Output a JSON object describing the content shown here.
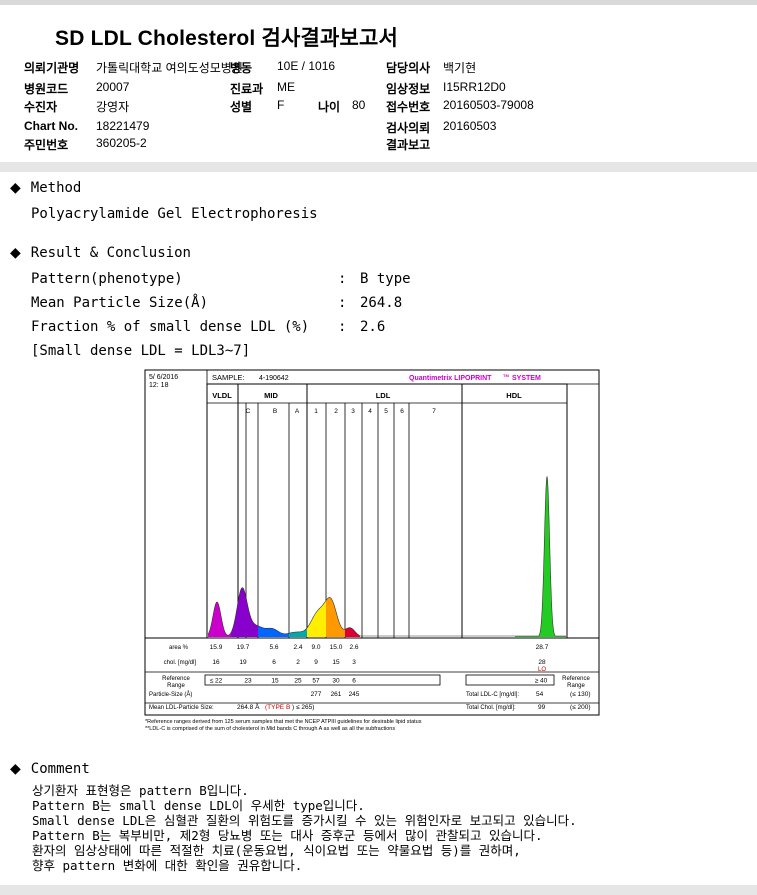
{
  "report": {
    "title": "SD LDL Cholesterol 검사결과보고서",
    "fields": {
      "hospital_label": "의뢰기관명",
      "hospital_value": "가톨릭대학교 여의도성모병원",
      "ward_label": "병동",
      "ward_value": "10E / 1016",
      "doctor_label": "담당의사",
      "doctor_value": "백기현",
      "code_label": "병원코드",
      "code_value": "20007",
      "dept_label": "진료과",
      "dept_value": "ME",
      "clinical_label": "임상정보",
      "clinical_value": "I15RR12D0",
      "patient_label": "수진자",
      "patient_value": "강영자",
      "sex_label": "성별",
      "sex_value": "F",
      "age_label": "나이",
      "age_value": "80",
      "receipt_label": "접수번호",
      "receipt_value": "20160503-79008",
      "chart_label": "Chart No.",
      "chart_value": "18221479",
      "request_label": "검사의뢰",
      "request_value": "20160503",
      "id_label": "주민번호",
      "id_value": "360205-2",
      "result_report_label": "결과보고",
      "result_report_value": ""
    }
  },
  "method": {
    "heading": "Method",
    "text": "Polyacrylamide Gel Electrophoresis"
  },
  "result": {
    "heading": "Result & Conclusion",
    "pattern_label": "Pattern(phenotype)",
    "pattern_value": "B type",
    "mps_label": "Mean Particle Size(Å)",
    "mps_value": "264.8",
    "fraction_label": "Fraction % of small dense LDL (%)",
    "fraction_value": "2.6",
    "note": "[Small dense LDL = LDL3~7]",
    "colon": ":"
  },
  "comment": {
    "heading": "Comment",
    "lines": [
      "상기환자 표현형은 pattern B입니다.",
      "Pattern B는 small dense LDL이 우세한 type입니다.",
      "Small dense LDL은 심혈관 질환의 위험도를 증가시킬 수 있는 위험인자로 보고되고 있습니다.",
      "Pattern B는 복부비만, 제2형 당뇨병 또는 대사 증후군 등에서 많이 관찰되고 있습니다.",
      "환자의 임상상태에 따른 적절한 치료(운동요법, 식이요법 또는 약물요법 등)를 권하며,",
      "향후 pattern 변화에 대한 확인을 권유합니다."
    ]
  },
  "chart_data": {
    "type": "area",
    "date": "5/ 6/2016",
    "time": "12: 18",
    "sample_label": "SAMPLE:",
    "sample_id": "4-190642",
    "brand": "Quantimetrix LIPOPRINT",
    "brand_tm": "TM",
    "brand_suffix": "SYSTEM",
    "regions": [
      "VLDL",
      "MID",
      "LDL",
      "HDL"
    ],
    "bands": [
      "C",
      "B",
      "A",
      "1",
      "2",
      "3",
      "4",
      "5",
      "6",
      "7"
    ],
    "area_label": "area %",
    "area_values": [
      "15.9",
      "19.7",
      "5.6",
      "2.4",
      "9.0",
      "15.0",
      "2.6",
      "28.7"
    ],
    "chol_label": "chol. [mg/dl]",
    "chol_values": [
      "16",
      "19",
      "6",
      "2",
      "9",
      "15",
      "3",
      "28"
    ],
    "lo_flag": "LO",
    "ref_label": "Reference Range",
    "ref_values": [
      "≤ 22",
      "23",
      "15",
      "25",
      "57",
      "30",
      "6"
    ],
    "hdl_ref": "≥ 40",
    "ref_right_label": "Reference Range",
    "particle_label": "Particle-Size (Å)",
    "particle_values": [
      "277",
      "261",
      "245"
    ],
    "mean_label": "Mean LDL-Particle Size:",
    "mean_value": "264.8 Å",
    "mean_type": "(TYPE B",
    "mean_ref": ") ≤ 265)",
    "total_ldl_label": "Total LDL-C [mg/dl]:",
    "total_ldl_value": "54",
    "total_ldl_ref": "(≤ 130)",
    "total_chol_label": "Total Chol. [mg/dl]:",
    "total_chol_value": "99",
    "total_chol_ref": "(≤ 200)",
    "footnote1": "*Reference ranges derived from 125 serum samples that met the NCEP ATPIII guidelines for desirable lipid status",
    "footnote2": "**LDL-C is comprised of the sum of cholesterol in Mid bands C through A as well as all the subfractions",
    "series": [
      {
        "name": "VLDL",
        "color": "#cc00cc",
        "peak": 15.9
      },
      {
        "name": "C",
        "color": "#8800cc",
        "peak": 19.7
      },
      {
        "name": "B",
        "color": "#0066ff",
        "peak": 5.6
      },
      {
        "name": "A",
        "color": "#00aaaa",
        "peak": 2.4
      },
      {
        "name": "1",
        "color": "#ffee00",
        "peak": 9.0
      },
      {
        "name": "2",
        "color": "#ff9900",
        "peak": 15.0
      },
      {
        "name": "3",
        "color": "#dd0033",
        "peak": 2.6
      },
      {
        "name": "HDL",
        "color": "#22cc22",
        "peak": 28.7
      }
    ]
  }
}
